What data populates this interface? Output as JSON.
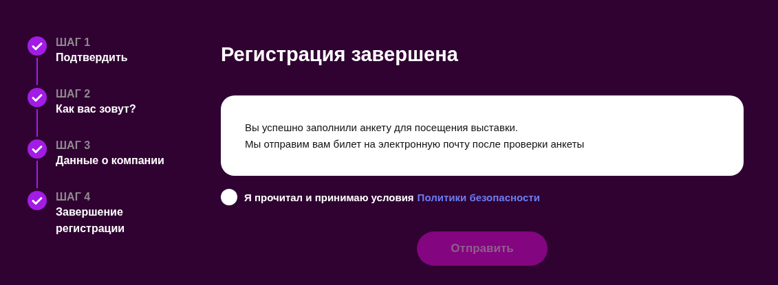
{
  "steps": [
    {
      "label": "ШАГ 1",
      "title": "Подтвердить",
      "completed": true
    },
    {
      "label": "ШАГ 2",
      "title": "Как вас зовут?",
      "completed": true
    },
    {
      "label": "ШАГ 3",
      "title": "Данные о компании",
      "completed": true
    },
    {
      "label": "ШАГ 4",
      "title": "Завершение регистрации",
      "completed": true
    }
  ],
  "heading": "Регистрация завершена",
  "message": [
    "Вы успешно заполнили анкету для посещения выставки.",
    "Мы отправим вам билет на электронную почту после проверки анкеты"
  ],
  "agreement": {
    "text": "Я прочитал и принимаю условия",
    "link": "Политики безопасности",
    "checked": false
  },
  "submit": {
    "label": "Отправить",
    "disabled": true
  }
}
